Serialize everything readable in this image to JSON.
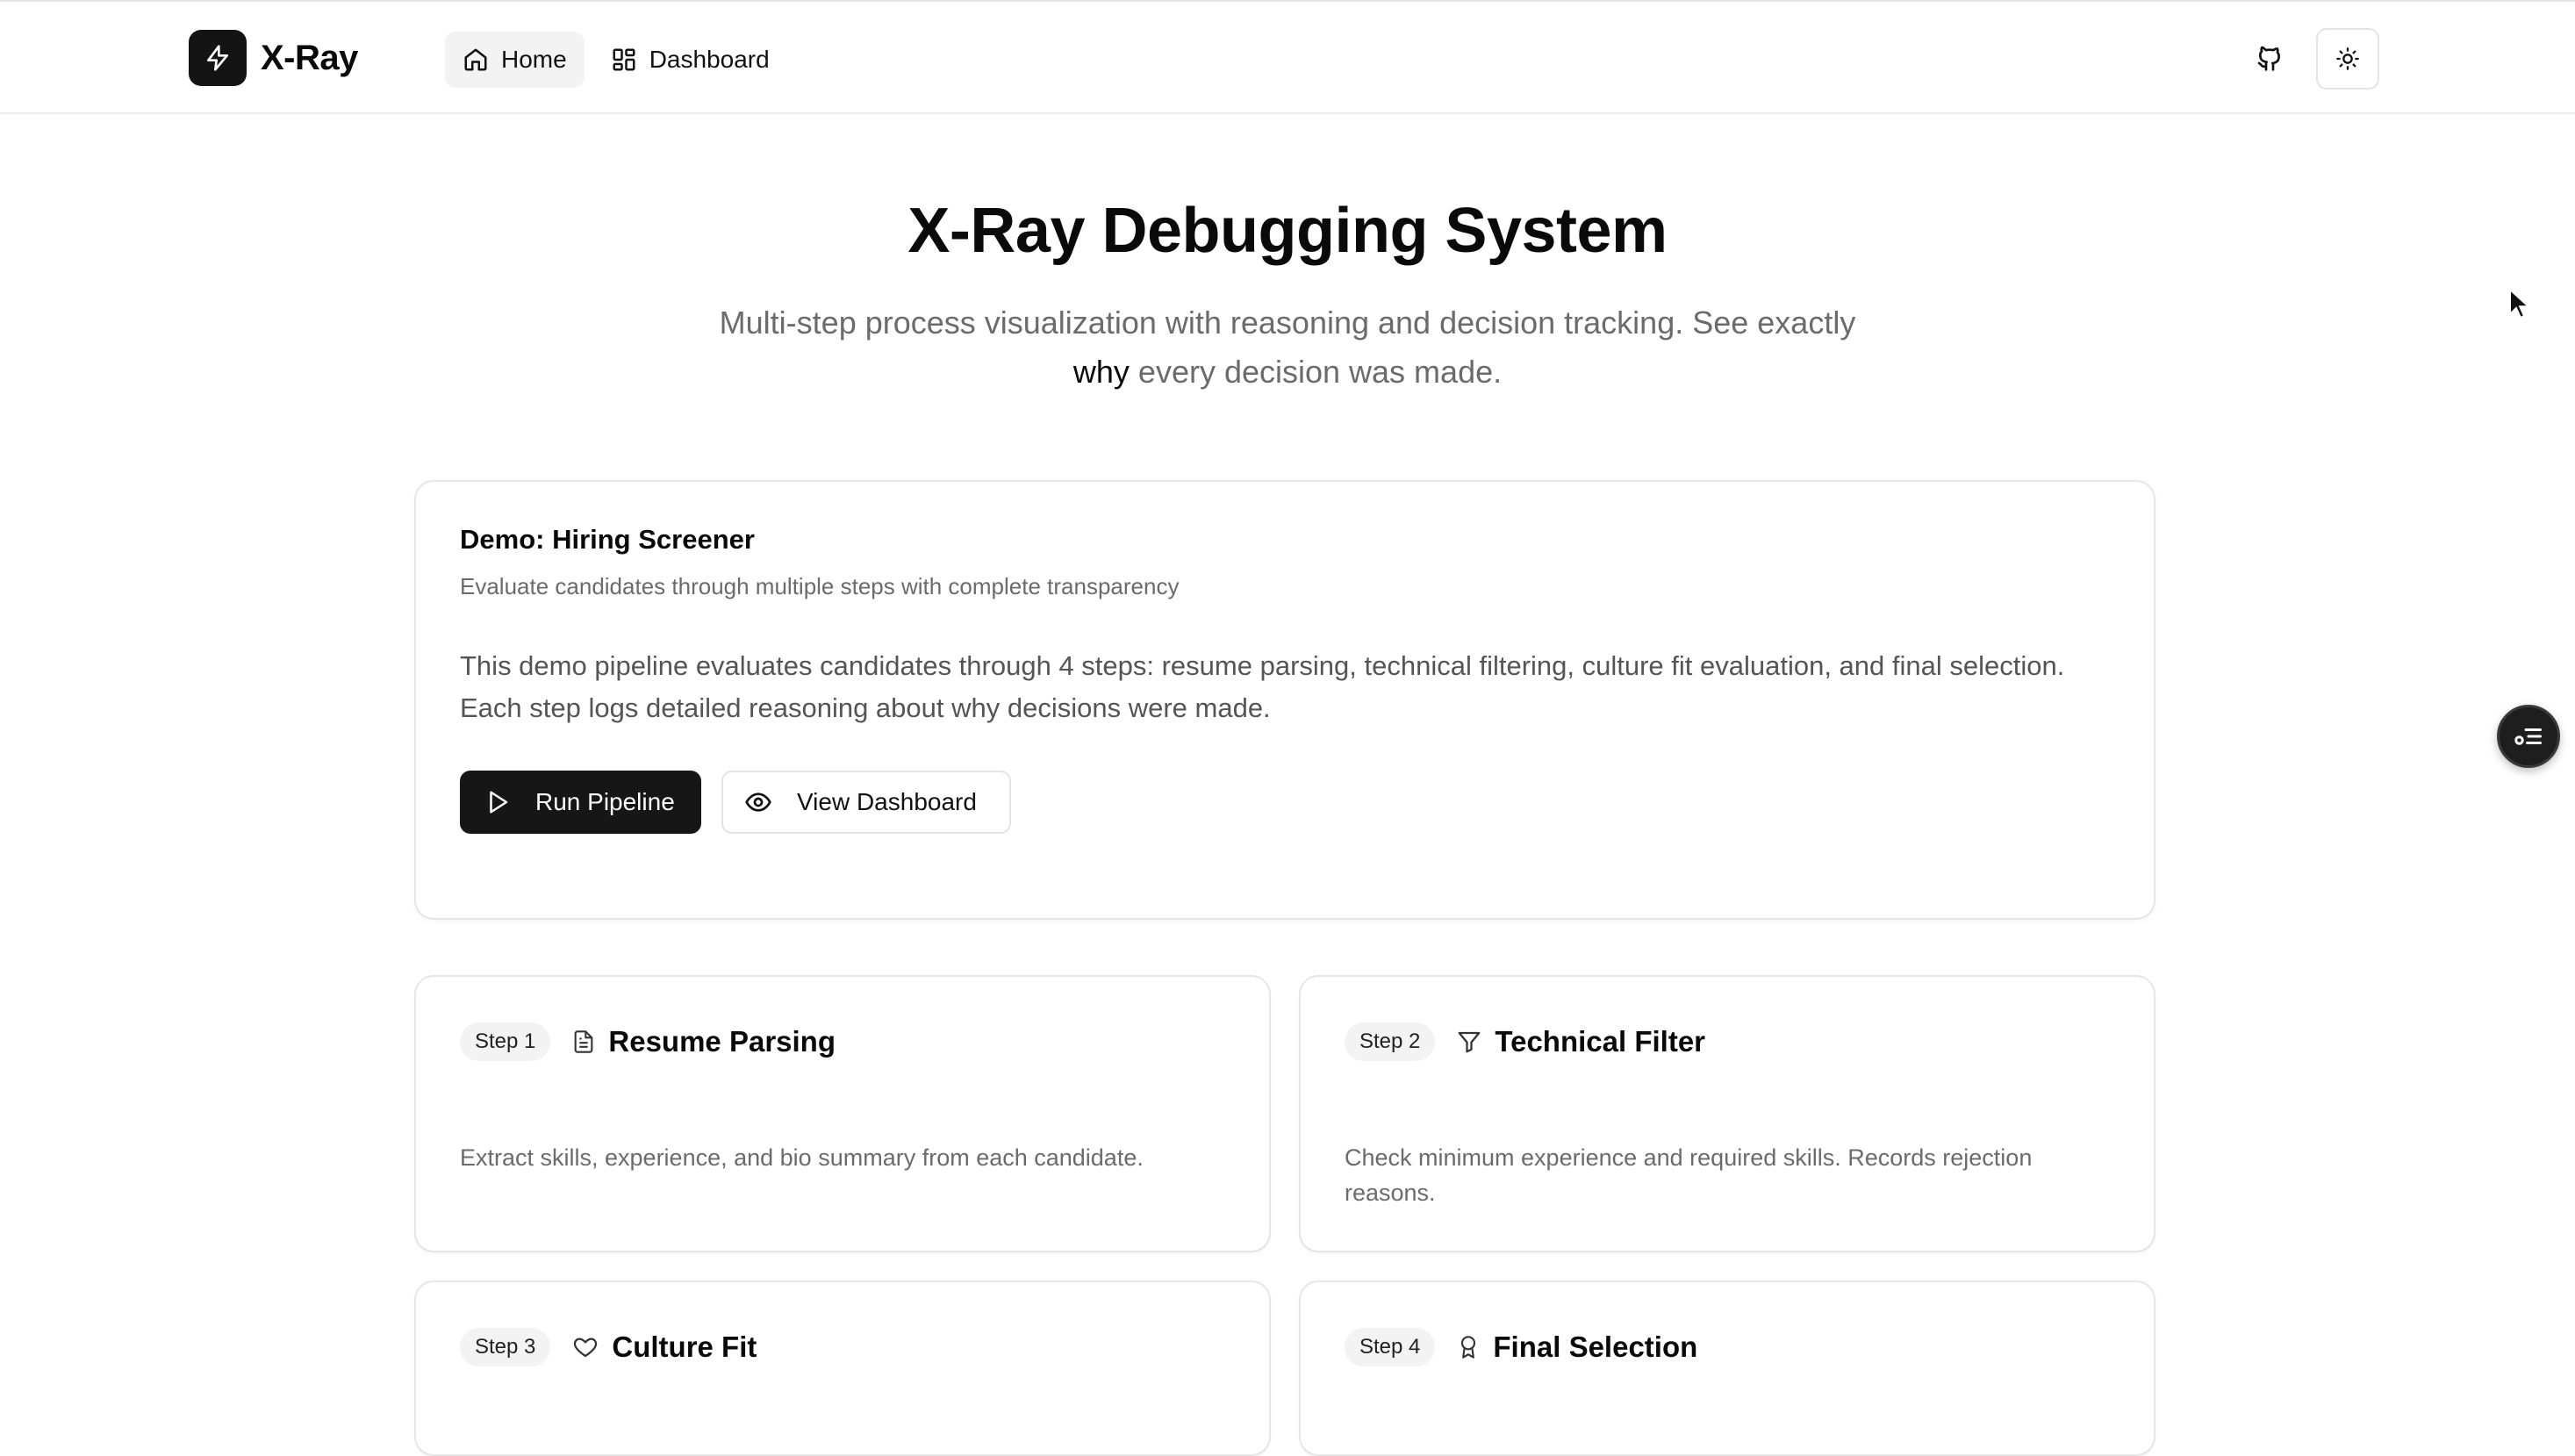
{
  "brand": {
    "name": "X-Ray",
    "logo_icon": "lightning-bolt-icon"
  },
  "nav": {
    "items": [
      {
        "label": "Home",
        "icon": "home-icon",
        "active": true
      },
      {
        "label": "Dashboard",
        "icon": "grid-icon",
        "active": false
      }
    ],
    "github_icon": "github-icon",
    "theme_icon": "sun-icon"
  },
  "hero": {
    "title": "X-Ray Debugging System",
    "subtitle_part1": "Multi-step process visualization with reasoning and decision tracking. See exactly",
    "subtitle_emphasis": "why",
    "subtitle_part2": "every decision was made."
  },
  "demo": {
    "title": "Demo: Hiring Screener",
    "subtitle": "Evaluate candidates through multiple steps with complete transparency",
    "description": "This demo pipeline evaluates candidates through 4 steps: resume parsing, technical filtering, culture fit evaluation, and final selection. Each step logs detailed reasoning about why decisions were made.",
    "run_button": "Run Pipeline",
    "view_button": "View Dashboard"
  },
  "steps": [
    {
      "badge": "Step 1",
      "title": "Resume Parsing",
      "icon": "document-icon",
      "description": "Extract skills, experience, and bio summary from each candidate."
    },
    {
      "badge": "Step 2",
      "title": "Technical Filter",
      "icon": "filter-icon",
      "description": "Check minimum experience and required skills. Records rejection reasons."
    },
    {
      "badge": "Step 3",
      "title": "Culture Fit",
      "icon": "heart-icon",
      "description": ""
    },
    {
      "badge": "Step 4",
      "title": "Final Selection",
      "icon": "award-icon",
      "description": ""
    }
  ],
  "colors": {
    "primary": "#161616",
    "muted_text": "#6b6b6b",
    "border": "#e6e6e6",
    "badge_bg": "#f3f3f3"
  }
}
